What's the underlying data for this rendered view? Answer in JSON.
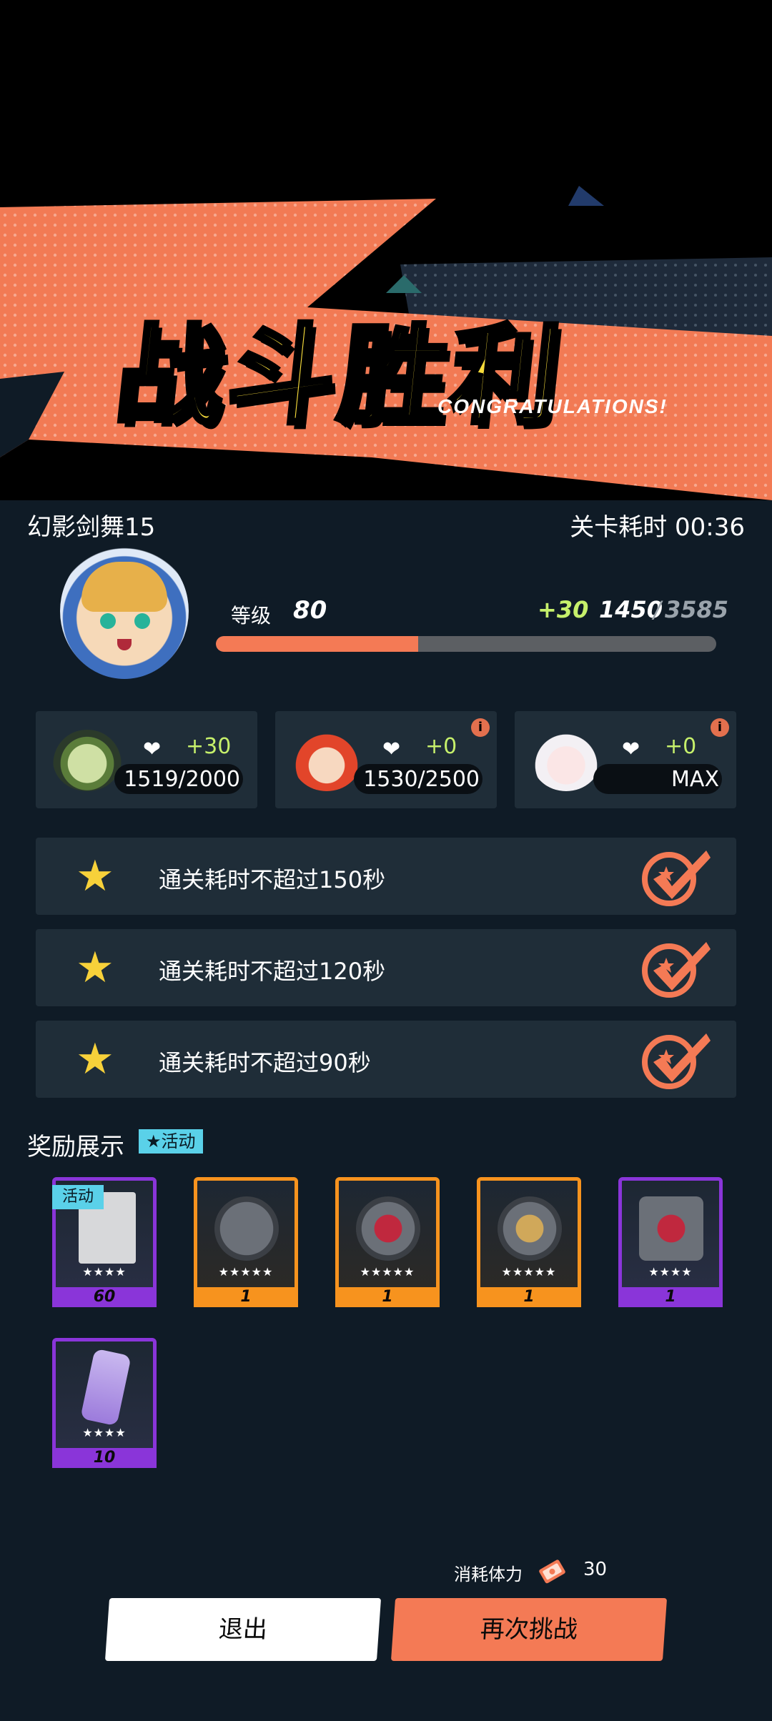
{
  "banner": {
    "title": "战斗胜利",
    "subtitle": "CONGRATULATIONS!"
  },
  "stage": {
    "name": "幻影剑舞15",
    "time_label": "关卡耗时 00:36"
  },
  "player": {
    "level_label": "等级",
    "level_value": "80",
    "exp_gain": "+30",
    "exp_current": "1450",
    "exp_slash": "/",
    "exp_max": "3585",
    "exp_progress": 0.4045
  },
  "characters": [
    {
      "heart": "❤",
      "gain": "+30",
      "count": "1519/2000",
      "info": false
    },
    {
      "heart": "❤",
      "gain": "+0",
      "count": "1530/2500",
      "info": true
    },
    {
      "heart": "❤",
      "gain": "+0",
      "count": "MAX",
      "info": true
    }
  ],
  "goals": [
    {
      "star": "★",
      "text": "通关耗时不超过150秒"
    },
    {
      "star": "★",
      "text": "通关耗时不超过120秒"
    },
    {
      "star": "★",
      "text": "通关耗时不超过90秒"
    }
  ],
  "rewards": {
    "title": "奖励展示",
    "event_tag": "★活动",
    "items": [
      {
        "rarity": "purple",
        "stars": "★★★★",
        "qty": "60",
        "tag": "活动",
        "icon": "photo-card-icon"
      },
      {
        "rarity": "orange",
        "stars": "★★★★★",
        "qty": "1",
        "tag": "",
        "icon": "crossbow-icon"
      },
      {
        "rarity": "orange",
        "stars": "★★★★★",
        "qty": "1",
        "tag": "",
        "icon": "red-glove-icon"
      },
      {
        "rarity": "orange",
        "stars": "★★★★★",
        "qty": "1",
        "tag": "",
        "icon": "mace-icon"
      },
      {
        "rarity": "purple",
        "stars": "★★★★",
        "qty": "1",
        "tag": "",
        "icon": "red-glove-icon"
      },
      {
        "rarity": "purple",
        "stars": "★★★★",
        "qty": "10",
        "tag": "",
        "icon": "spray-can-icon"
      }
    ]
  },
  "footer": {
    "stamina_label": "消耗体力",
    "stamina_value": "30",
    "exit_label": "退出",
    "retry_label": "再次挑战"
  },
  "colors": {
    "accent": "#f47a55",
    "title_yellow": "#f7dc3b",
    "gain_green": "#c6f06b",
    "purple": "#8a35d9",
    "orange": "#f7931e",
    "event_cyan": "#5ad1e9"
  }
}
